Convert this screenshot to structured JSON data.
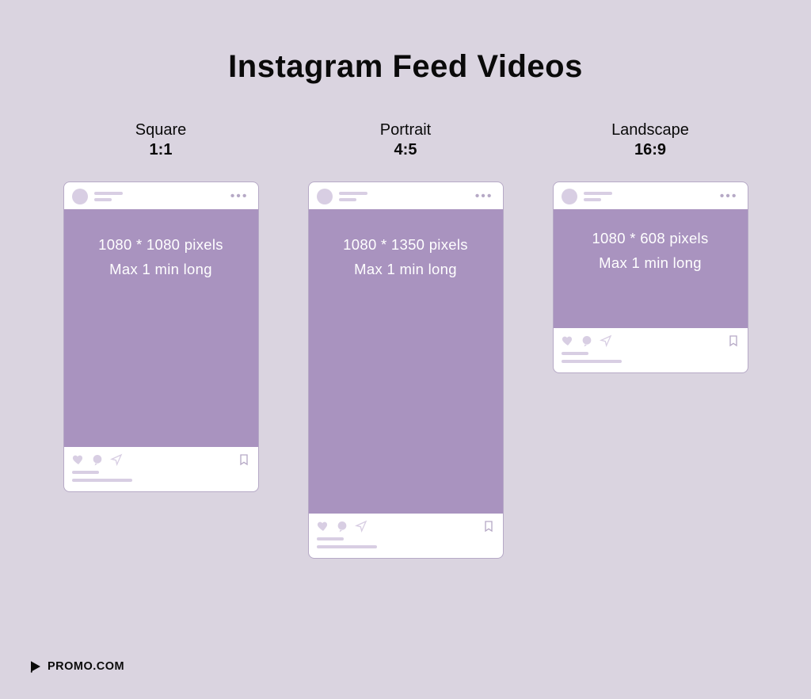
{
  "title": "Instagram Feed Videos",
  "brand": "PROMO.COM",
  "formats": {
    "square": {
      "name": "Square",
      "ratio": "1:1",
      "dimensions": "1080 * 1080 pixels",
      "duration": "Max 1 min long"
    },
    "portrait": {
      "name": "Portrait",
      "ratio": "4:5",
      "dimensions": "1080 * 1350 pixels",
      "duration": "Max 1 min long"
    },
    "landscape": {
      "name": "Landscape",
      "ratio": "16:9",
      "dimensions": "1080 * 608 pixels",
      "duration": "Max 1 min long"
    }
  },
  "colors": {
    "background": "#dad4e0",
    "card_fill": "#a993bf",
    "card_border": "#b6a9c6",
    "placeholder": "#d8cee3"
  }
}
